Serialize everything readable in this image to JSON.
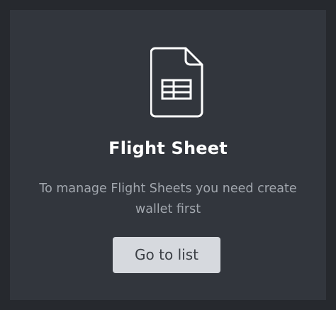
{
  "card": {
    "icon": "spreadsheet-icon",
    "title": "Flight Sheet",
    "description": "To manage Flight Sheets you need create wallet first",
    "button_label": "Go to list"
  },
  "colors": {
    "page_bg": "#26292e",
    "card_bg": "#32363d",
    "title": "#ffffff",
    "description": "#a2a7ae",
    "button_bg": "#d6d9de",
    "button_text": "#3b3f45"
  }
}
